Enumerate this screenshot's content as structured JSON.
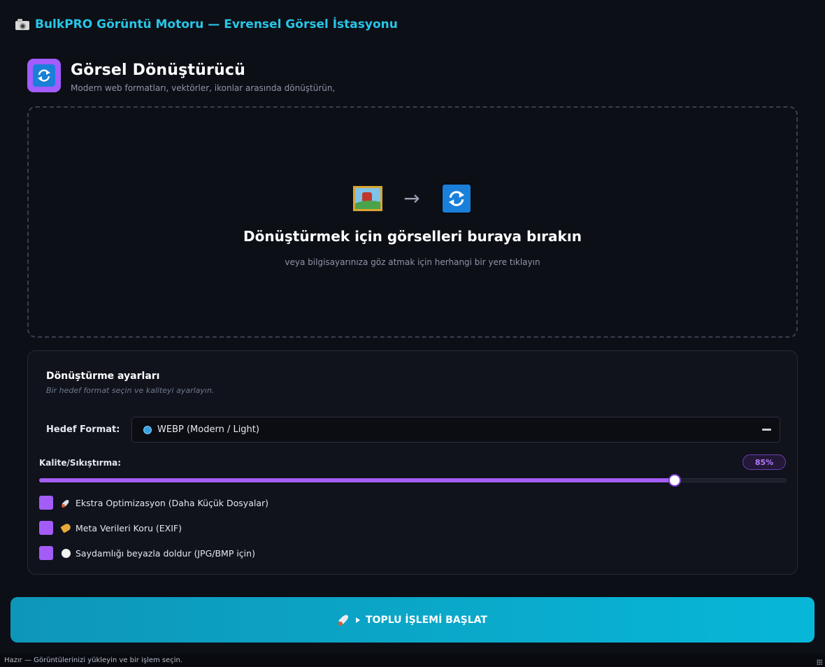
{
  "app": {
    "title": "BulkPRO Görüntü Motoru — Evrensel Görsel İstasyonu",
    "icon": "camera-icon"
  },
  "header": {
    "title": "Görsel Dönüştürücü",
    "subtitle": "Modern web formatları, vektörler, ikonlar arasında dönüştürün,",
    "icon": "refresh-icon",
    "accent": "#a35cff"
  },
  "dropzone": {
    "title": "Dönüştürmek için görselleri buraya bırakın",
    "subtitle": "veya bilgisayarınıza göz atmak için herhangi bir yere tıklayın",
    "arrow": "→",
    "icons": [
      "picture-icon",
      "refresh-icon"
    ]
  },
  "settings": {
    "title": "Dönüştürme ayarları",
    "subtitle": "Bir hedef format seçin ve kaliteyi ayarlayın.",
    "format": {
      "label": "Hedef Format:",
      "value": "WEBP (Modern / Light)",
      "icon": "globe-icon"
    },
    "quality": {
      "label": "Kalite/Sıkıştırma:",
      "value_text": "85%",
      "value": 85,
      "color": "#a45cf7"
    },
    "options": [
      {
        "label": "Ekstra Optimizasyon (Daha Küçük Dosyalar)",
        "icon": "rocket-icon",
        "checked": true
      },
      {
        "label": "Meta Verileri Koru (EXIF)",
        "icon": "tag-icon",
        "checked": true
      },
      {
        "label": "Saydamlığı beyazla doldur (JPG/BMP için)",
        "icon": "white-circle-icon",
        "checked": true
      }
    ]
  },
  "action": {
    "start_label": "TOPLU İŞLEMİ BAŞLAT",
    "color": "#07b7d8"
  },
  "status": {
    "text": "Hazır — Görüntülerinizi yükleyin ve bir işlem seçin."
  }
}
